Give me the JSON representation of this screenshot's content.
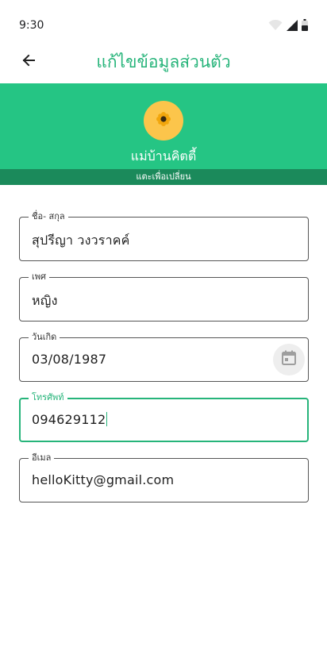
{
  "status_bar": {
    "time": "9:30"
  },
  "header": {
    "title": "แก้ไขข้อมูลส่วนตัว"
  },
  "profile": {
    "name": "แม่บ้านคิตตี้",
    "change_hint": "แตะเพื่อเปลี่ยน"
  },
  "form": {
    "full_name": {
      "label": "ชื่อ- สกุล",
      "value": "สุปรีญา วงวราคค์"
    },
    "gender": {
      "label": "เพศ",
      "value": "หญิง"
    },
    "birthdate": {
      "label": "วันเกิด",
      "value": "03/08/1987"
    },
    "phone": {
      "label": "โทรศัพท์",
      "value": "094629112"
    },
    "email": {
      "label": "อีเมล",
      "value": "helloKitty@gmail.com"
    }
  },
  "colors": {
    "accent": "#26b47a",
    "banner": "#25c584",
    "banner_strip": "#1b8a5b",
    "avatar_bg": "#fcc54b"
  },
  "icons": [
    "wifi-icon",
    "signal-icon",
    "battery-icon",
    "back-arrow-icon",
    "flower-icon",
    "calendar-icon"
  ]
}
